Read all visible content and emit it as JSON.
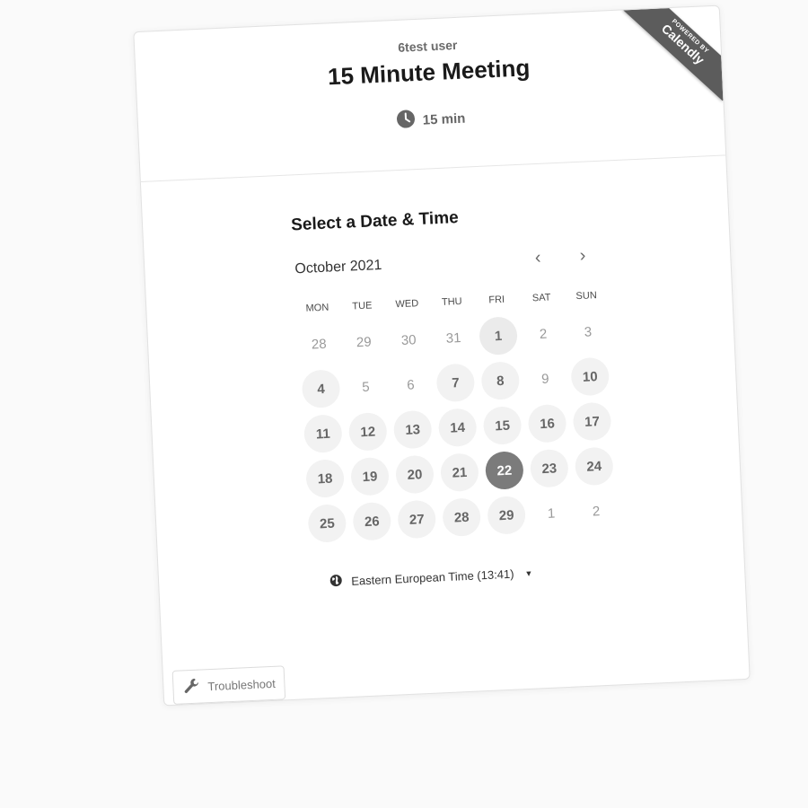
{
  "header": {
    "user_name": "6test user",
    "event_title": "15 Minute Meeting",
    "duration": "15 min"
  },
  "branding": {
    "ribbon_small": "POWERED BY",
    "ribbon_brand": "Calendly"
  },
  "picker": {
    "title": "Select a Date & Time",
    "month_label": "October 2021",
    "prev_symbol": "‹",
    "next_symbol": "›"
  },
  "calendar": {
    "weekdays": [
      "MON",
      "TUE",
      "WED",
      "THU",
      "FRI",
      "SAT",
      "SUN"
    ],
    "days": [
      {
        "label": "28",
        "state": "muted"
      },
      {
        "label": "29",
        "state": "muted"
      },
      {
        "label": "30",
        "state": "muted"
      },
      {
        "label": "31",
        "state": "muted"
      },
      {
        "label": "1",
        "state": "today"
      },
      {
        "label": "2",
        "state": "muted"
      },
      {
        "label": "3",
        "state": "muted"
      },
      {
        "label": "4",
        "state": "available"
      },
      {
        "label": "5",
        "state": "muted"
      },
      {
        "label": "6",
        "state": "muted"
      },
      {
        "label": "7",
        "state": "available"
      },
      {
        "label": "8",
        "state": "available"
      },
      {
        "label": "9",
        "state": "muted"
      },
      {
        "label": "10",
        "state": "available"
      },
      {
        "label": "11",
        "state": "available"
      },
      {
        "label": "12",
        "state": "available"
      },
      {
        "label": "13",
        "state": "available"
      },
      {
        "label": "14",
        "state": "available"
      },
      {
        "label": "15",
        "state": "available"
      },
      {
        "label": "16",
        "state": "available"
      },
      {
        "label": "17",
        "state": "available"
      },
      {
        "label": "18",
        "state": "available"
      },
      {
        "label": "19",
        "state": "available"
      },
      {
        "label": "20",
        "state": "available"
      },
      {
        "label": "21",
        "state": "available"
      },
      {
        "label": "22",
        "state": "selected"
      },
      {
        "label": "23",
        "state": "available"
      },
      {
        "label": "24",
        "state": "available"
      },
      {
        "label": "25",
        "state": "available"
      },
      {
        "label": "26",
        "state": "available"
      },
      {
        "label": "27",
        "state": "available"
      },
      {
        "label": "28",
        "state": "available"
      },
      {
        "label": "29",
        "state": "available"
      },
      {
        "label": "1",
        "state": "muted"
      },
      {
        "label": "2",
        "state": "muted"
      }
    ]
  },
  "timezone": {
    "label": "Eastern European Time (13:41)"
  },
  "troubleshoot": {
    "label": "Troubleshoot"
  },
  "icons": {
    "clock": "clock-icon",
    "globe": "globe-icon",
    "wrench": "wrench-icon",
    "prev": "chevron-left-icon",
    "next": "chevron-right-icon"
  },
  "colors": {
    "selected_day": "#7b7b7b",
    "available_day": "#f2f2f2",
    "ribbon": "#5c5c5c"
  }
}
